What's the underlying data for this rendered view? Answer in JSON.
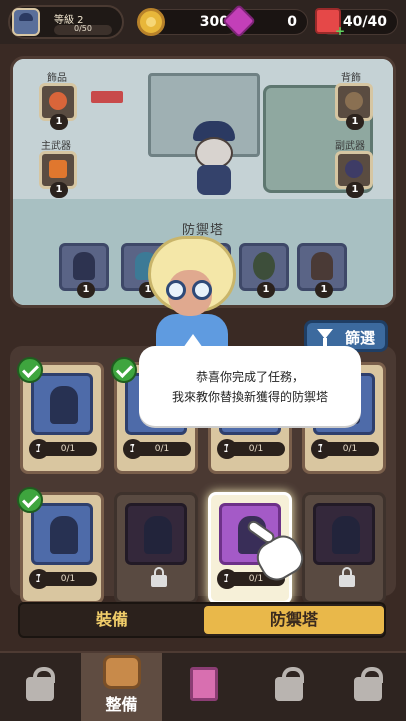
{
  "topbar": {
    "level_label": "等級 2",
    "xp_progress": "0/50",
    "gold": "300",
    "gems": "0",
    "energy": "40/40"
  },
  "showcase": {
    "slots": {
      "accessory": {
        "label": "飾品",
        "count": "1"
      },
      "main_weapon": {
        "label": "主武器",
        "count": "1"
      },
      "back_decor": {
        "label": "背飾",
        "count": "1"
      },
      "sub_weapon": {
        "label": "副武器",
        "count": "1"
      }
    },
    "section_title": "防禦塔",
    "towers": [
      {
        "count": "1"
      },
      {
        "count": "1"
      },
      {
        "count": "1"
      },
      {
        "count": "1"
      },
      {
        "count": "1"
      }
    ]
  },
  "filter": {
    "label": "篩選"
  },
  "bubble": {
    "line1": "恭喜你完成了任務，",
    "line2": "我來教你替換新獲得的防禦塔"
  },
  "cards": [
    {
      "level": "1",
      "progress": "0/1",
      "checked": true
    },
    {
      "level": "1",
      "progress": "0/1",
      "checked": true
    },
    {
      "level": "1",
      "progress": "0/1",
      "checked": false
    },
    {
      "level": "1",
      "progress": "0/1",
      "checked": false
    },
    {
      "level": "1",
      "progress": "0/1",
      "checked": true
    },
    {
      "level": "",
      "progress": "",
      "locked": true
    },
    {
      "level": "1",
      "progress": "0/1",
      "selected": true
    },
    {
      "level": "",
      "progress": "",
      "locked": true
    }
  ],
  "tabs": {
    "equipment": "裝備",
    "towers": "防禦塔"
  },
  "nav": {
    "equip_label": "整備"
  },
  "colors": {
    "accent": "#e9b84a",
    "filter_blue": "#3c6a9e",
    "check_green": "#3ea53e"
  }
}
